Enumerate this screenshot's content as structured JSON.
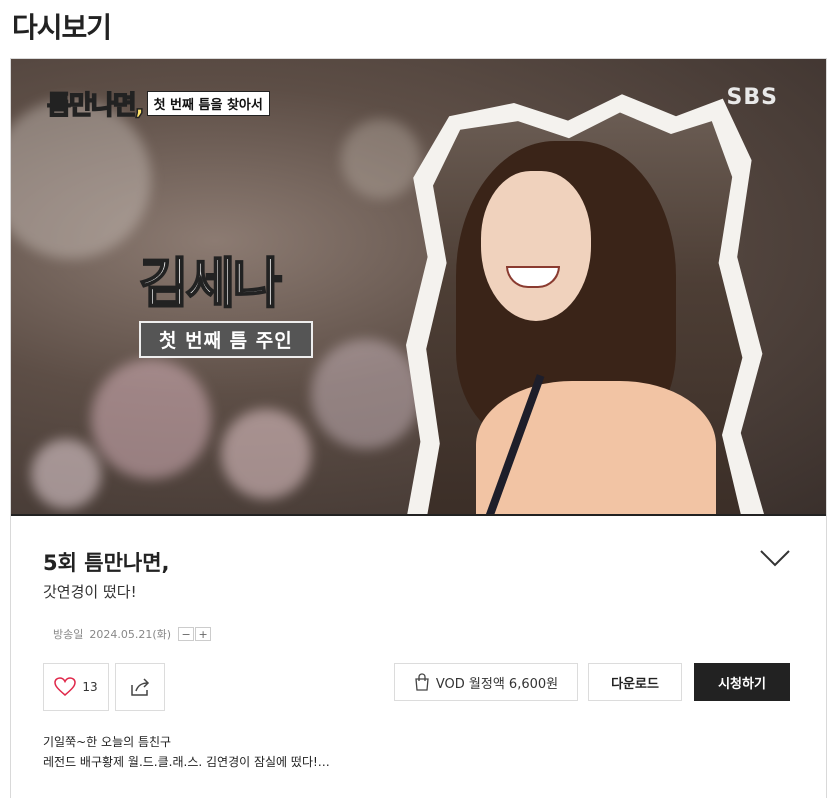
{
  "page": {
    "title": "다시보기"
  },
  "hero": {
    "show_logo": "틈만나면,",
    "episode_tag": "첫 번째 틈을 찾아서",
    "broadcaster_logo": "SBS",
    "name_caption": "김세나",
    "sub_caption": "첫 번째 틈 주인"
  },
  "episode": {
    "title": "5회 틈만나면,",
    "subtitle": "갓연경이 떴다!",
    "airdate_label": "방송일",
    "airdate_value": "2024.05.21(화)",
    "font_decrease": "−",
    "font_increase": "+",
    "description_line1": "기일쭉~한 오늘의 틈친구",
    "description_line2": "레전드 배구황제 월.드.클.래.스. 김연경이 잠실에 떴다!…"
  },
  "actions": {
    "like_count": "13",
    "vod_label": "VOD 월정액 6,600원",
    "download_label": "다운로드",
    "watch_label": "시청하기"
  },
  "icons": {
    "expand": "chevron-down-icon",
    "like": "heart-icon",
    "share": "share-icon",
    "vod": "shopping-bag-icon"
  }
}
